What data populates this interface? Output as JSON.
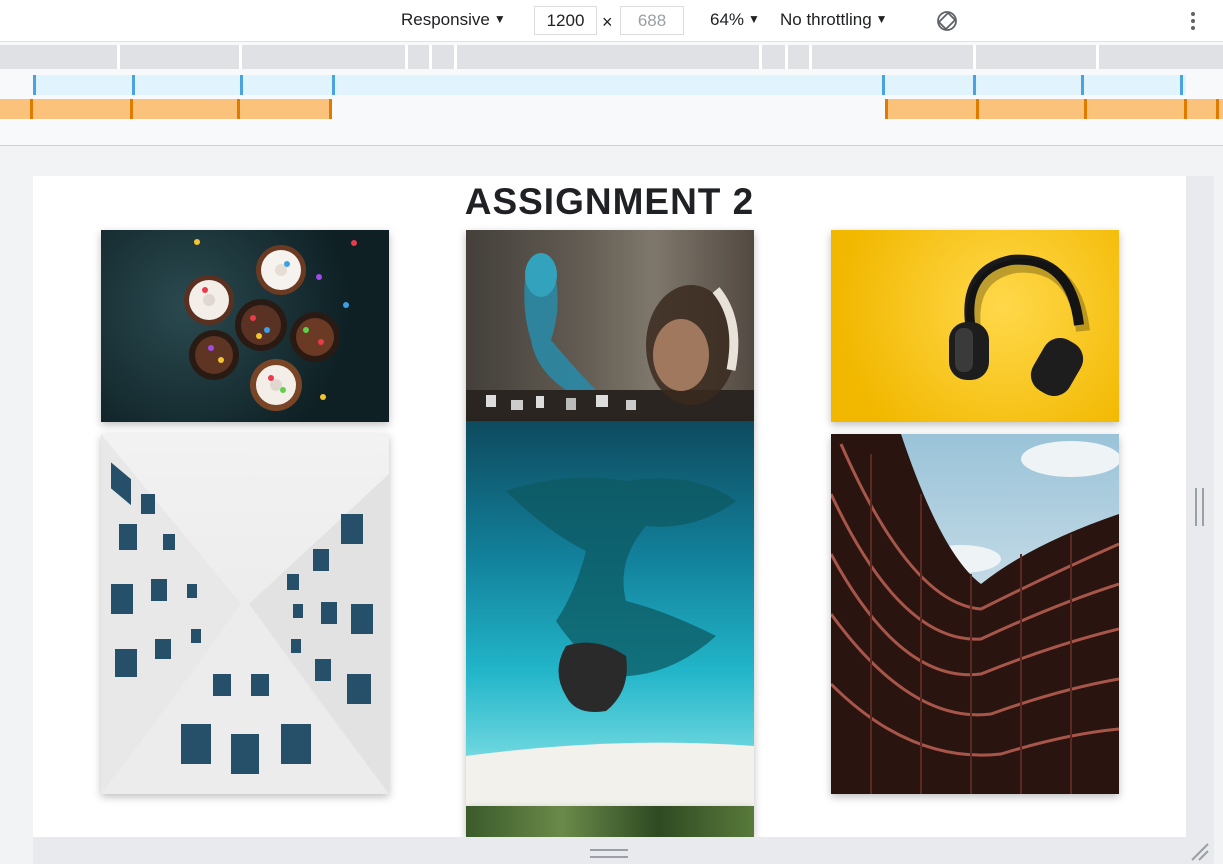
{
  "toolbar": {
    "device_label": "Responsive",
    "width_value": "1200",
    "times_symbol": "×",
    "height_placeholder": "688",
    "zoom_label": "64%",
    "throttle_label": "No throttling",
    "caret": "▼"
  },
  "page": {
    "heading": "ASSIGNMENT 2"
  },
  "images": [
    {
      "subject": "cupcakes"
    },
    {
      "subject": "graffiti-headphones"
    },
    {
      "subject": "headphones-yellow"
    },
    {
      "subject": "building-perspective"
    },
    {
      "subject": "ocean-aerial"
    },
    {
      "subject": "curved-building"
    },
    {
      "subject": "palm-trees"
    }
  ],
  "colors": {
    "media_query_max": "#e1f3fd",
    "media_query_min": "#fbc27b",
    "media_query_tick_blue": "#4aa3e0",
    "media_query_tick_orange": "#e07b00"
  }
}
